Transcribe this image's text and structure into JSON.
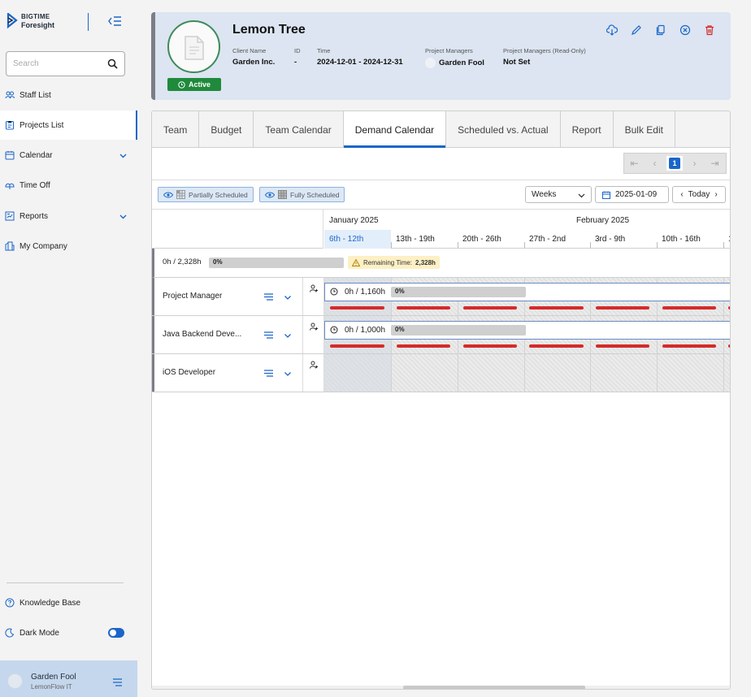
{
  "brand": {
    "line1": "BIGTIME",
    "line2": "Foresight"
  },
  "sidebar": {
    "search_placeholder": "Search",
    "items": [
      {
        "label": "Staff List",
        "icon": "staff-icon"
      },
      {
        "label": "Projects List",
        "icon": "projects-icon"
      },
      {
        "label": "Calendar",
        "icon": "calendar-icon"
      },
      {
        "label": "Time Off",
        "icon": "time-off-icon"
      },
      {
        "label": "Reports",
        "icon": "reports-icon"
      },
      {
        "label": "My Company",
        "icon": "company-icon"
      }
    ],
    "bottom": [
      {
        "label": "Knowledge Base",
        "icon": "help-icon"
      },
      {
        "label": "Dark Mode",
        "icon": "moon-icon"
      }
    ],
    "user": {
      "name": "Garden Fool",
      "org": "LemonFlow IT"
    }
  },
  "project": {
    "title": "Lemon Tree",
    "status": "Active",
    "meta": [
      {
        "label": "Client Name",
        "value": "Garden Inc."
      },
      {
        "label": "ID",
        "value": "-"
      },
      {
        "label": "Time",
        "value": "2024-12-01 - 2024-12-31"
      },
      {
        "label": "Project Managers",
        "value": "Garden Fool"
      },
      {
        "label": "Project Managers (Read-Only)",
        "value": "Not Set"
      }
    ]
  },
  "tabs": [
    "Team",
    "Budget",
    "Team Calendar",
    "Demand Calendar",
    "Scheduled vs. Actual",
    "Report",
    "Bulk Edit"
  ],
  "active_tab": "Demand Calendar",
  "pager": {
    "current": "1"
  },
  "filters": {
    "partial": "Partially Scheduled",
    "full": "Fully Scheduled"
  },
  "view": {
    "mode": "Weeks",
    "date": "2025-01-09",
    "today": "Today"
  },
  "calendar": {
    "months": [
      "January 2025",
      "February 2025"
    ],
    "weeks": [
      "6th - 12th",
      "13th - 19th",
      "20th - 26th",
      "27th - 2nd",
      "3rd - 9th",
      "10th - 16th",
      "1"
    ],
    "summary": {
      "hours": "0h / 2,328h",
      "pct": "0%",
      "remaining_label": "Remaining Time:",
      "remaining_value": "2,328h"
    },
    "roles": [
      {
        "name": "Project Manager",
        "hours": "0h / 1,160h",
        "pct": "0%"
      },
      {
        "name": "Java Backend Deve...",
        "hours": "0h / 1,000h",
        "pct": "0%"
      },
      {
        "name": "iOS Developer"
      }
    ]
  },
  "colors": {
    "accent": "#1a66c9",
    "active_badge": "#1f8a3b",
    "warn_bg": "#fdf0c5",
    "demand_red": "#d62a2a"
  }
}
